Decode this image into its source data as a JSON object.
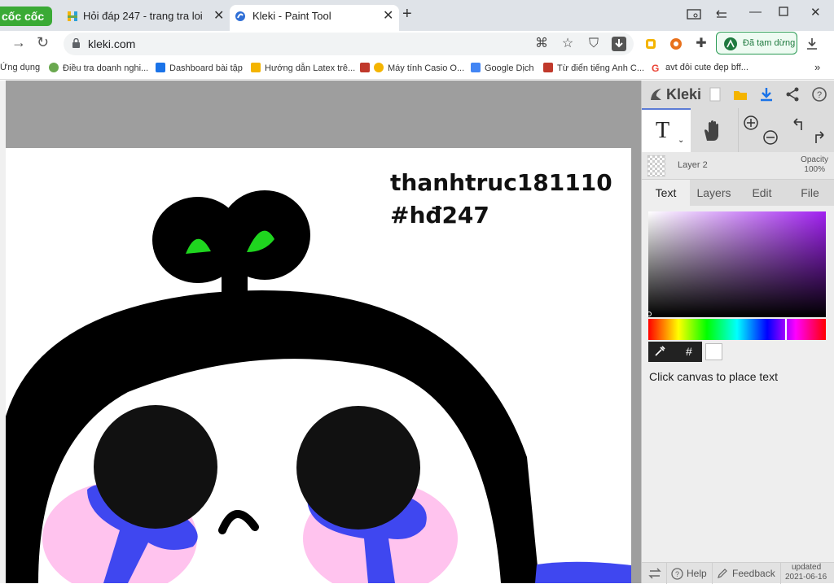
{
  "browser": {
    "brand": "cốc cốc",
    "tabs": [
      {
        "title": "Hỏi đáp 247 - trang tra loi",
        "active": false
      },
      {
        "title": "Kleki - Paint Tool",
        "active": true
      }
    ],
    "url": "kleki.com",
    "paused_label": "Đã tạm dừng",
    "bookmarks": [
      {
        "label": "Ứng dụng",
        "color": "#4285f4"
      },
      {
        "label": "Điều tra doanh nghi...",
        "color": "#6aa84f"
      },
      {
        "label": "Dashboard bài tập",
        "color": "#1a73e8"
      },
      {
        "label": "Hướng dẫn Latex trê...",
        "color": "#f4b400"
      },
      {
        "label": "Máy tính Casio O...",
        "color": "#f4b400"
      },
      {
        "label": "Google Dịch",
        "color": "#4285f4"
      },
      {
        "label": "Từ điển tiếng Anh C...",
        "color": "#c0392b"
      },
      {
        "label": "avt đôi cute đẹp bff...",
        "color": "#ea4335"
      }
    ],
    "more": "»"
  },
  "canvas": {
    "line1": "thanhtruc181110",
    "line2": "#hđ247"
  },
  "kleki": {
    "brand": "Kleki",
    "layer_name": "Layer 2",
    "opacity_label": "Opacity",
    "opacity_value": "100%",
    "tabs": [
      "Text",
      "Layers",
      "Edit",
      "File"
    ],
    "active_tab": "Text",
    "hex_symbol": "#",
    "hint": "Click canvas to place text",
    "footer_help": "Help",
    "footer_feedback": "Feedback",
    "footer_updated": "updated",
    "footer_date": "2021-06-16",
    "colors": {
      "accent": "#5b7bd5",
      "selected_color": "#ffffff"
    }
  }
}
